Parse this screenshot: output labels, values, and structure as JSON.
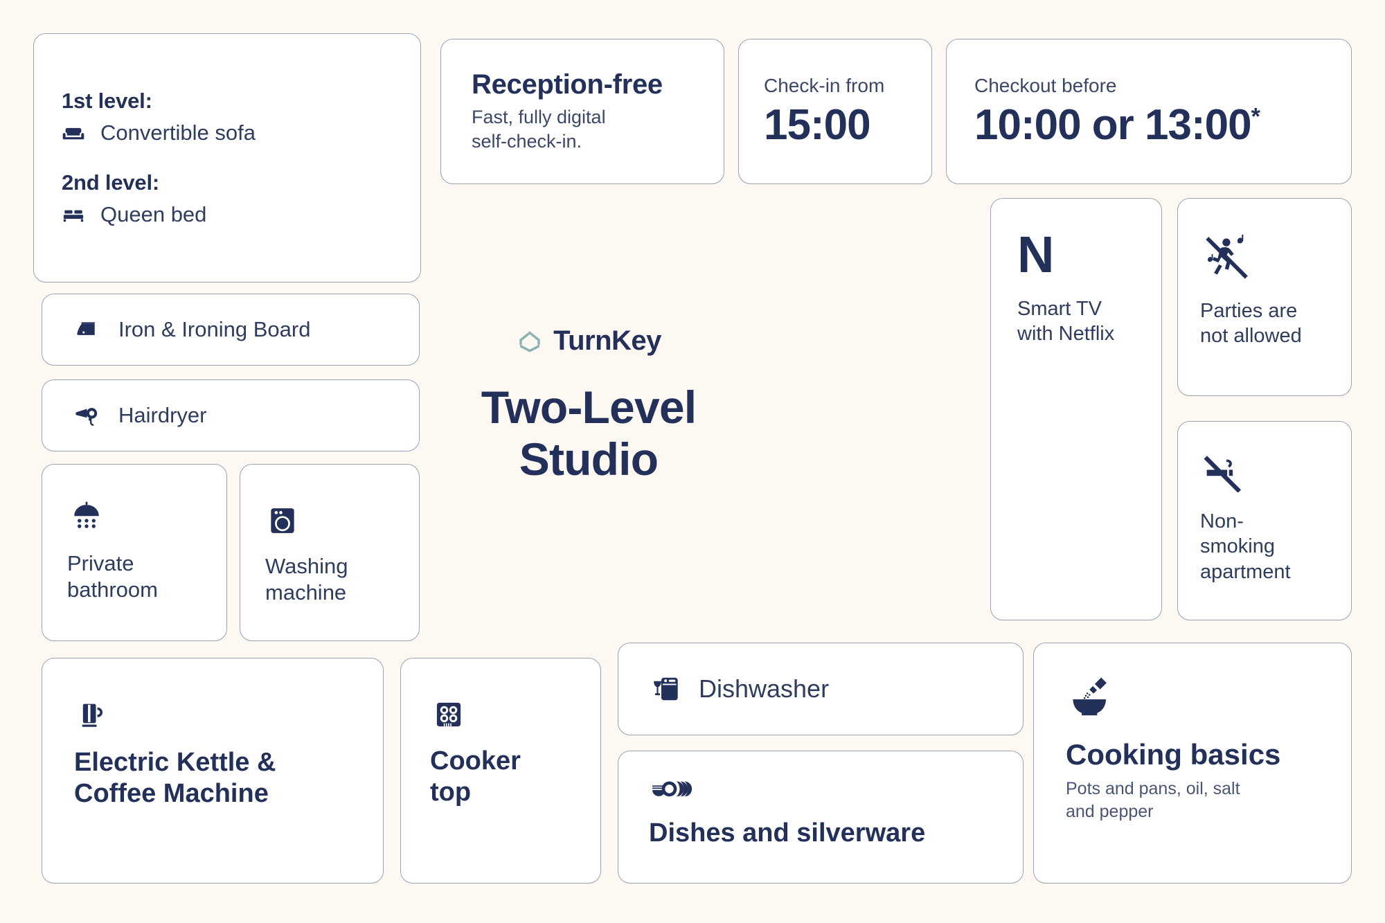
{
  "theme": {
    "background": "#FDF8F2",
    "card_background": "#FFFFFF",
    "card_border": "#9AA2B4",
    "ink": "#2B3A63",
    "accent_navy": "#22305A",
    "logo_teal": "#8BB3B3"
  },
  "brand": {
    "name": "TurnKey",
    "logo_icon": "hexagon-house-icon"
  },
  "hero": {
    "title_line1": "Two-Level",
    "title_line2": "Studio"
  },
  "sleeping": {
    "level1_heading": "1st level:",
    "level1_item": "Convertible sofa",
    "level1_icon": "sofa-icon",
    "level2_heading": "2nd level:",
    "level2_item": "Queen bed",
    "level2_icon": "bed-icon"
  },
  "reception": {
    "title": "Reception-free",
    "subtitle_line1": "Fast, fully digital",
    "subtitle_line2": "self-check-in."
  },
  "checkin": {
    "label": "Check-in from",
    "time": "15:00"
  },
  "checkout": {
    "label": "Checkout before",
    "time": "10:00 or 13:00",
    "footnote_marker": "*"
  },
  "amenities": {
    "iron": {
      "label": "Iron & Ironing Board",
      "icon": "iron-icon"
    },
    "hairdryer": {
      "label": "Hairdryer",
      "icon": "hairdryer-icon"
    },
    "bathroom": {
      "label_line1": "Private",
      "label_line2": "bathroom",
      "icon": "shower-icon"
    },
    "washing_machine": {
      "label_line1": "Washing",
      "label_line2": "machine",
      "icon": "washing-machine-icon"
    },
    "kettle": {
      "label_line1": "Electric Kettle &",
      "label_line2": "Coffee Machine",
      "icon": "kettle-icon"
    },
    "cooker": {
      "label_line1": "Cooker",
      "label_line2": "top",
      "icon": "cooktop-icon"
    },
    "dishwasher": {
      "label": "Dishwasher",
      "icon": "dishwasher-icon"
    },
    "dishes": {
      "label": "Dishes and silverware",
      "icon": "dishes-icon"
    },
    "cooking_basics": {
      "title": "Cooking basics",
      "subtitle_line1": "Pots and pans, oil, salt",
      "subtitle_line2": "and pepper",
      "icon": "mortar-salt-icon"
    },
    "smart_tv": {
      "logo_letter": "N",
      "label_line1": "Smart TV",
      "label_line2": "with Netflix",
      "icon": "netflix-n-icon"
    }
  },
  "rules": {
    "no_parties": {
      "label_line1": "Parties are",
      "label_line2": "not allowed",
      "icon": "no-parties-icon"
    },
    "no_smoking": {
      "label_line1": "Non-",
      "label_line2": "smoking",
      "label_line3": "apartment",
      "icon": "no-smoking-icon"
    }
  }
}
